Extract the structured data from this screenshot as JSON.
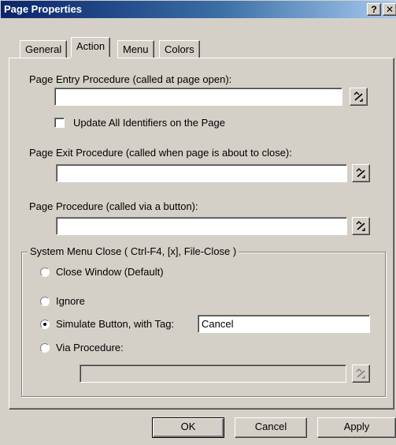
{
  "window": {
    "title": "Page Properties",
    "help_glyph": "?",
    "close_glyph": "✕"
  },
  "tabs": [
    {
      "label": "General",
      "active": false
    },
    {
      "label": "Action",
      "active": true
    },
    {
      "label": "Menu",
      "active": false
    },
    {
      "label": "Colors",
      "active": false
    }
  ],
  "action": {
    "entry_label": "Page Entry Procedure (called at page open):",
    "entry_value": "",
    "update_all_label": "Update All Identifiers on the Page",
    "update_all_checked": false,
    "exit_label": "Page Exit Procedure (called when page is about to close):",
    "exit_value": "",
    "page_proc_label": "Page Procedure (called via a button):",
    "page_proc_value": ""
  },
  "system_menu_close": {
    "title": "System Menu Close  ( Ctrl-F4,  [x],  File-Close )",
    "options": [
      {
        "label": "Close Window (Default)",
        "checked": false
      },
      {
        "label": "Ignore",
        "checked": false
      },
      {
        "label": "Simulate Button, with Tag:",
        "checked": true
      },
      {
        "label": "Via Procedure:",
        "checked": false
      }
    ],
    "tag_value": "Cancel",
    "via_procedure_value": ""
  },
  "buttons": {
    "ok": "OK",
    "cancel": "Cancel",
    "apply": "Apply"
  },
  "icons": {
    "picker": "procedure-picker-icon"
  },
  "colors": {
    "title_start": "#0a246a",
    "title_end": "#a6caf0",
    "face": "#d4d0c8"
  }
}
